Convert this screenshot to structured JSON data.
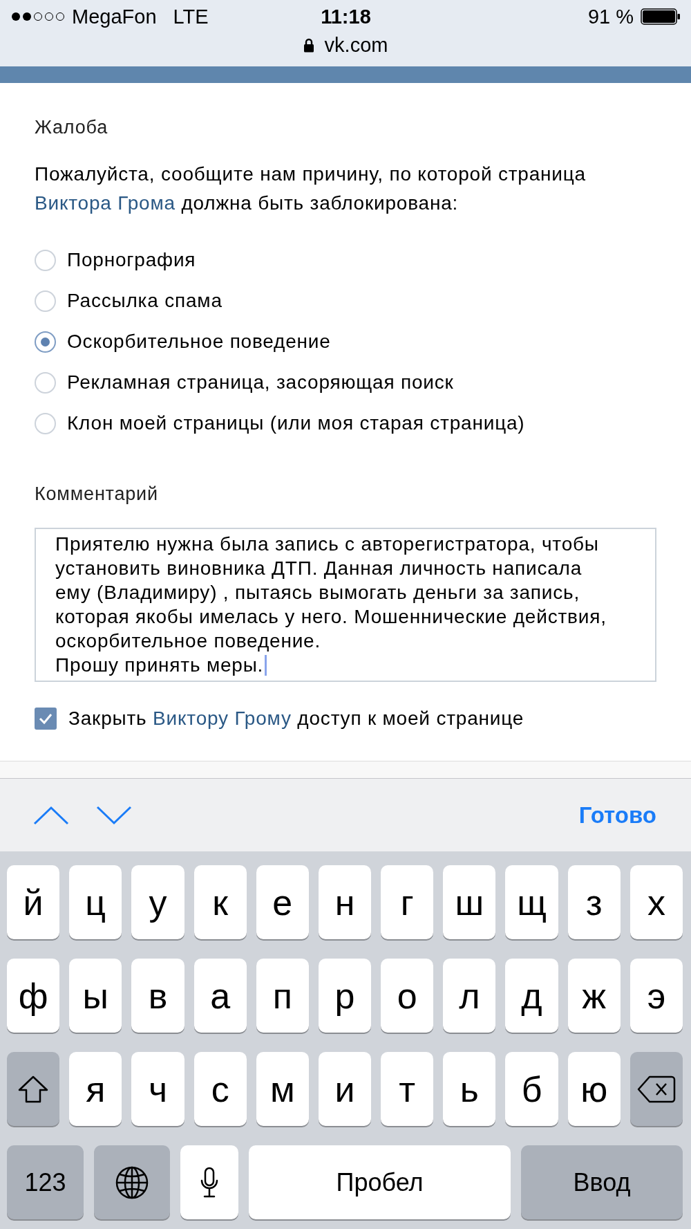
{
  "status_bar": {
    "carrier": "MegaFon",
    "network": "LTE",
    "time": "11:18",
    "battery": "91 %"
  },
  "address_bar": {
    "url": "vk.com"
  },
  "report_form": {
    "title": "Жалоба",
    "prompt": {
      "text_before": "Пожалуйста, сообщите нам причину, по которой страница",
      "link": "Виктора Грома",
      "text_after": "должна быть заблокирована:"
    },
    "reasons": [
      {
        "label": "Порнография",
        "selected": false
      },
      {
        "label": "Рассылка спама",
        "selected": false
      },
      {
        "label": "Оскорбительное поведение",
        "selected": true
      },
      {
        "label": "Рекламная страница, засоряющая поиск",
        "selected": false
      },
      {
        "label": "Клон моей страницы (или моя старая страница)",
        "selected": false
      }
    ],
    "comment": {
      "label": "Комментарий",
      "value": "Приятелю нужна была запись с авторегистратора, чтобы установить виновника ДТП. Данная личность написала ему (Владимиру) , пытаясь вымогать деньги за запись, которая якобы имелась у него. Мошеннические действия, оскорбительное поведение.\nПрошу принять меры."
    },
    "block_option": {
      "text_before": "Закрыть",
      "link": "Виктору Грому",
      "text_after": "доступ к моей странице",
      "checked": true
    }
  },
  "keyboard_toolbar": {
    "done": "Готово"
  },
  "keyboard": {
    "letter_rows": [
      [
        {
          "kind": "letter",
          "label": "й"
        },
        {
          "kind": "letter",
          "label": "ц"
        },
        {
          "kind": "letter",
          "label": "у"
        },
        {
          "kind": "letter",
          "label": "к"
        },
        {
          "kind": "letter",
          "label": "е"
        },
        {
          "kind": "letter",
          "label": "н"
        },
        {
          "kind": "letter",
          "label": "г"
        },
        {
          "kind": "letter",
          "label": "ш"
        },
        {
          "kind": "letter",
          "label": "щ"
        },
        {
          "kind": "letter",
          "label": "з"
        },
        {
          "kind": "letter",
          "label": "х"
        }
      ],
      [
        {
          "kind": "letter",
          "label": "ф"
        },
        {
          "kind": "letter",
          "label": "ы"
        },
        {
          "kind": "letter",
          "label": "в"
        },
        {
          "kind": "letter",
          "label": "а"
        },
        {
          "kind": "letter",
          "label": "п"
        },
        {
          "kind": "letter",
          "label": "р"
        },
        {
          "kind": "letter",
          "label": "о"
        },
        {
          "kind": "letter",
          "label": "л"
        },
        {
          "kind": "letter",
          "label": "д"
        },
        {
          "kind": "letter",
          "label": "ж"
        },
        {
          "kind": "letter",
          "label": "э"
        }
      ],
      [
        {
          "kind": "shift"
        },
        {
          "kind": "letter",
          "label": "я"
        },
        {
          "kind": "letter",
          "label": "ч"
        },
        {
          "kind": "letter",
          "label": "с"
        },
        {
          "kind": "letter",
          "label": "м"
        },
        {
          "kind": "letter",
          "label": "и"
        },
        {
          "kind": "letter",
          "label": "т"
        },
        {
          "kind": "letter",
          "label": "ь"
        },
        {
          "kind": "letter",
          "label": "б"
        },
        {
          "kind": "letter",
          "label": "ю"
        },
        {
          "kind": "backspace"
        }
      ]
    ],
    "bottom_row": [
      {
        "kind": "numbers",
        "label": "123"
      },
      {
        "kind": "globe"
      },
      {
        "kind": "mic"
      },
      {
        "kind": "space",
        "label": "Пробел"
      },
      {
        "kind": "return",
        "label": "Ввод"
      }
    ]
  }
}
